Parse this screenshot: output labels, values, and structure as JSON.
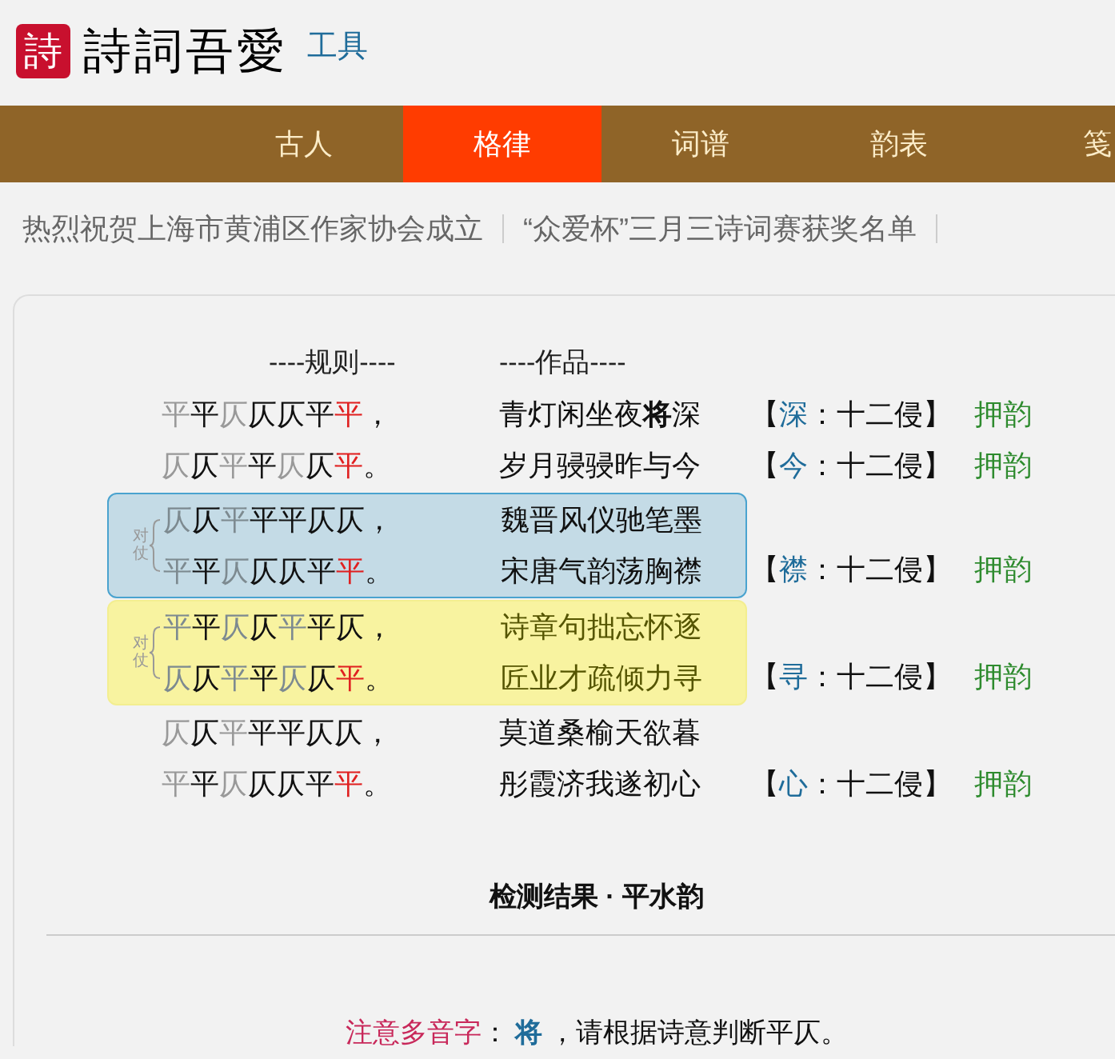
{
  "logo": {
    "mark": "詩",
    "name": "詩詞吾愛",
    "section": "工具"
  },
  "nav": [
    {
      "label": "古人",
      "selected": false
    },
    {
      "label": "格律",
      "selected": true
    },
    {
      "label": "词谱",
      "selected": false
    },
    {
      "label": "韵表",
      "selected": false
    },
    {
      "label": "笺",
      "selected": false
    }
  ],
  "news": [
    "热烈祝贺上海市黄浦区作家协会成立",
    "“众爱杯”三月三诗词赛获奖名单"
  ],
  "headers": {
    "rules": "----规则----",
    "poem": "----作品----"
  },
  "blocks": [
    {
      "kind": "plain",
      "lines": [
        {
          "pattern": [
            {
              "text": "平",
              "optional": true,
              "rhyme": false
            },
            {
              "text": "平",
              "optional": false,
              "rhyme": false
            },
            {
              "text": "仄",
              "optional": true,
              "rhyme": false
            },
            {
              "text": "仄",
              "optional": false,
              "rhyme": false
            },
            {
              "text": "仄",
              "optional": false,
              "rhyme": false
            },
            {
              "text": "平",
              "optional": false,
              "rhyme": false
            },
            {
              "text": "平",
              "optional": false,
              "rhyme": true
            },
            {
              "text": "，",
              "optional": false,
              "rhyme": false
            }
          ],
          "poem": "青灯闲坐夜**将**深",
          "rhyme": [
            "【",
            "深",
            "：十二侵】"
          ],
          "status": "押韵"
        },
        {
          "pattern": [
            {
              "text": "仄",
              "optional": true,
              "rhyme": false
            },
            {
              "text": "仄",
              "optional": false,
              "rhyme": false
            },
            {
              "text": "平",
              "optional": true,
              "rhyme": false
            },
            {
              "text": "平",
              "optional": false,
              "rhyme": false
            },
            {
              "text": "仄",
              "optional": true,
              "rhyme": false
            },
            {
              "text": "仄",
              "optional": false,
              "rhyme": false
            },
            {
              "text": "平",
              "optional": false,
              "rhyme": true
            },
            {
              "text": "。",
              "optional": false,
              "rhyme": false
            }
          ],
          "poem": "岁月骎骎昨与今",
          "rhyme": [
            "【",
            "今",
            "：十二侵】"
          ],
          "status": "押韵"
        }
      ]
    },
    {
      "kind": "parallel",
      "label": "对仗",
      "color": "#c4dbe6",
      "lines": [
        {
          "pattern": [
            {
              "text": "仄",
              "optional": true,
              "rhyme": false
            },
            {
              "text": "仄",
              "optional": false,
              "rhyme": false
            },
            {
              "text": "平",
              "optional": true,
              "rhyme": false
            },
            {
              "text": "平",
              "optional": false,
              "rhyme": false
            },
            {
              "text": "平",
              "optional": false,
              "rhyme": false
            },
            {
              "text": "仄",
              "optional": false,
              "rhyme": false
            },
            {
              "text": "仄",
              "optional": false,
              "rhyme": false
            },
            {
              "text": "，",
              "optional": false,
              "rhyme": false
            }
          ],
          "poem": "魏晋风仪驰笔墨"
        },
        {
          "pattern": [
            {
              "text": "平",
              "optional": true,
              "rhyme": false
            },
            {
              "text": "平",
              "optional": false,
              "rhyme": false
            },
            {
              "text": "仄",
              "optional": true,
              "rhyme": false
            },
            {
              "text": "仄",
              "optional": false,
              "rhyme": false
            },
            {
              "text": "仄",
              "optional": false,
              "rhyme": false
            },
            {
              "text": "平",
              "optional": false,
              "rhyme": false
            },
            {
              "text": "平",
              "optional": false,
              "rhyme": true
            },
            {
              "text": "。",
              "optional": false,
              "rhyme": false
            }
          ],
          "poem": "宋唐气韵荡胸襟",
          "rhyme": [
            "【",
            "襟",
            "：十二侵】"
          ],
          "status": "押韵"
        }
      ]
    },
    {
      "kind": "parallel",
      "label": "对仗",
      "color": "#f8f3a0",
      "lines": [
        {
          "pattern": [
            {
              "text": "平",
              "optional": true,
              "rhyme": false
            },
            {
              "text": "平",
              "optional": false,
              "rhyme": false
            },
            {
              "text": "仄",
              "optional": true,
              "rhyme": false
            },
            {
              "text": "仄",
              "optional": false,
              "rhyme": false
            },
            {
              "text": "平",
              "optional": true,
              "rhyme": false
            },
            {
              "text": "平",
              "optional": false,
              "rhyme": false
            },
            {
              "text": "仄",
              "optional": false,
              "rhyme": false
            },
            {
              "text": "，",
              "optional": false,
              "rhyme": false
            }
          ],
          "poem": "诗章句拙忘怀逐"
        },
        {
          "pattern": [
            {
              "text": "仄",
              "optional": true,
              "rhyme": false
            },
            {
              "text": "仄",
              "optional": false,
              "rhyme": false
            },
            {
              "text": "平",
              "optional": true,
              "rhyme": false
            },
            {
              "text": "平",
              "optional": false,
              "rhyme": false
            },
            {
              "text": "仄",
              "optional": true,
              "rhyme": false
            },
            {
              "text": "仄",
              "optional": false,
              "rhyme": false
            },
            {
              "text": "平",
              "optional": false,
              "rhyme": true
            },
            {
              "text": "。",
              "optional": false,
              "rhyme": false
            }
          ],
          "poem": "匠业才疏倾力寻",
          "rhyme": [
            "【",
            "寻",
            "：十二侵】"
          ],
          "status": "押韵"
        }
      ]
    },
    {
      "kind": "plain",
      "lines": [
        {
          "pattern": [
            {
              "text": "仄",
              "optional": true,
              "rhyme": false
            },
            {
              "text": "仄",
              "optional": false,
              "rhyme": false
            },
            {
              "text": "平",
              "optional": true,
              "rhyme": false
            },
            {
              "text": "平",
              "optional": false,
              "rhyme": false
            },
            {
              "text": "平",
              "optional": false,
              "rhyme": false
            },
            {
              "text": "仄",
              "optional": false,
              "rhyme": false
            },
            {
              "text": "仄",
              "optional": false,
              "rhyme": false
            },
            {
              "text": "，",
              "optional": false,
              "rhyme": false
            }
          ],
          "poem": "莫道桑榆天欲暮"
        },
        {
          "pattern": [
            {
              "text": "平",
              "optional": true,
              "rhyme": false
            },
            {
              "text": "平",
              "optional": false,
              "rhyme": false
            },
            {
              "text": "仄",
              "optional": true,
              "rhyme": false
            },
            {
              "text": "仄",
              "optional": false,
              "rhyme": false
            },
            {
              "text": "仄",
              "optional": false,
              "rhyme": false
            },
            {
              "text": "平",
              "optional": false,
              "rhyme": false
            },
            {
              "text": "平",
              "optional": false,
              "rhyme": true
            },
            {
              "text": "。",
              "optional": false,
              "rhyme": false
            }
          ],
          "poem": "彤霞济我遂初心",
          "rhyme": [
            "【",
            "心",
            "：十二侵】"
          ],
          "status": "押韵"
        }
      ]
    }
  ],
  "result": {
    "title": "检测结果 · 平水韵",
    "note_label": "注意多音字",
    "note_sep": "：",
    "note_char": "将",
    "note_text": "，请根据诗意判断平仄。"
  }
}
